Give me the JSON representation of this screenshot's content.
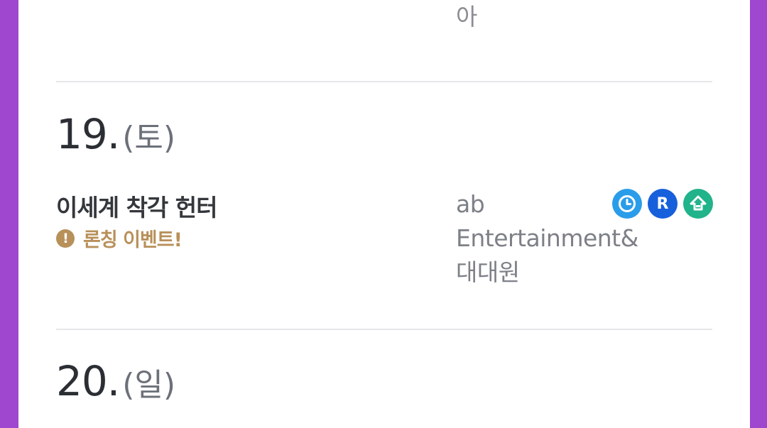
{
  "previous_entry": {
    "author_tail": "아"
  },
  "days": [
    {
      "day_number": "19.",
      "day_of_week": "(토)",
      "title": "이세계 착각 헌터",
      "notice": "론칭 이벤트!",
      "author_lines": [
        "ab",
        "Entertainment&",
        "대대원"
      ],
      "badges": [
        {
          "icon": "timer-icon",
          "color": "#2a9dea"
        },
        {
          "icon": "ridi-icon",
          "label": "R",
          "color": "#1760dc"
        },
        {
          "icon": "green-store-icon",
          "color": "#21b38a"
        }
      ]
    },
    {
      "day_number": "20.",
      "day_of_week": "(일)"
    }
  ],
  "colors": {
    "frame": "#9f47cf",
    "notice": "#b8905a",
    "divider": "#e6e7ea"
  }
}
